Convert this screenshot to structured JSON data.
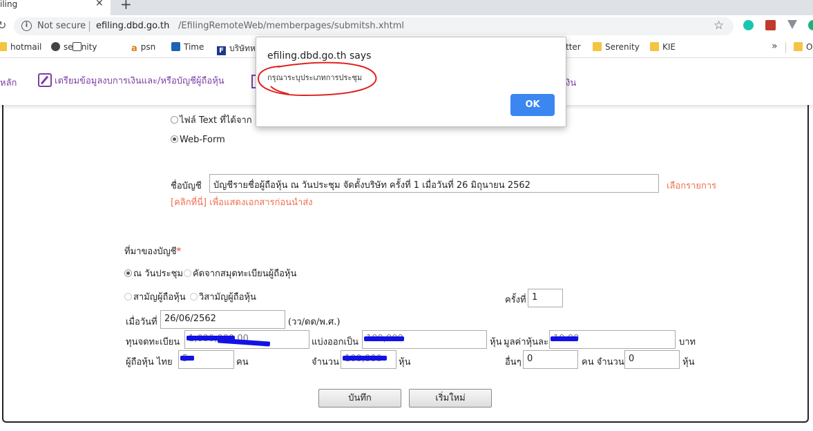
{
  "browser": {
    "tab_title": "iling",
    "address": {
      "security_label": "Not secure",
      "separator": "|",
      "host": "efiling.dbd.go.th",
      "path": "/EfilingRemoteWeb/memberpages/submitsh.xhtml"
    },
    "bookmarks": [
      {
        "label": "hotmail",
        "icon": "folder-icon"
      },
      {
        "label": "serenity",
        "icon": "github-icon"
      },
      {
        "label": "psn",
        "icon": "book-icon"
      },
      {
        "label": "Time",
        "icon": "amazon-icon"
      },
      {
        "label": "บริษัทห",
        "icon": "time-icon"
      },
      {
        "label": "tter",
        "icon": "folder-icon"
      },
      {
        "label": "Serenity",
        "icon": "folder-icon"
      },
      {
        "label": "KIE",
        "icon": "folder-icon"
      },
      {
        "label": "O",
        "icon": "folder-icon"
      }
    ],
    "more_bookmarks": "»"
  },
  "nav": {
    "home_label": "หลัก",
    "item1_label": "เตรียมข้อมูลงบการเงินและ/หรือบัญชีผู้ถือหุ้น",
    "item3_label": "งิน"
  },
  "form": {
    "source_text_file": "ไฟล์ Text ที่ได้จาก",
    "source_webform": "Web-Form",
    "account_name_label": "ชื่อบัญชี",
    "account_name_value": "บัญชีรายชื่อผู้ถือหุ้น  ณ วันประชุม จัดตั้งบริษัท ครั้งที่ 1  เมื่อวันที่ 26 มิถุนายน 2562",
    "select_item_link": "เลือกรายการ",
    "preview_link": "[คลิกที่นี่] เพื่อแสดงเอกสารก่อนนำส่ง",
    "origin_label": "ที่มาของบัญชี",
    "required_mark": "*",
    "origin_meeting": "ณ วันประชุม",
    "origin_register": "คัดจากสมุดทะเบียนผู้ถือหุ้น",
    "meeting_ordinary": "สามัญผู้ถือหุ้น",
    "meeting_extraordinary": "วิสามัญผู้ถือหุ้น",
    "times_label": "ครั้งที่",
    "times_value": "1",
    "date_label": "เมื่อวันที่",
    "date_value": "26/06/2562",
    "date_format": "(วว/ดด/พ.ศ.)",
    "capital_label": "ทุนจดทะเบียน",
    "capital_value": "1,000,000.00",
    "divided_label": "แบ่งออกเป็น",
    "divided_value": "100,000",
    "share_unit": "หุ้น",
    "par_label": "มูลค่าหุ้นละ",
    "par_value": "10.00",
    "baht_unit": "บาท",
    "thai_holders_label": "ผู้ถือหุ้น ไทย",
    "thai_holders_value": "5",
    "person_unit": "คน",
    "amount_label": "จำนวน",
    "amount_value": "100,000",
    "other_label": "อื่นๆ",
    "other_holders_value": "0",
    "other_person_amount": "คน จำนวน",
    "other_amount_value": "0",
    "save_button": "บันทึก",
    "reset_button": "เริ่มใหม่"
  },
  "dialog": {
    "title": "efiling.dbd.go.th says",
    "message": "กรุณาระบุประเภทการประชุม",
    "ok_label": "OK",
    "annotation_color": "#e02020"
  },
  "colors": {
    "nav_purple": "#7b3fa4",
    "link_orange": "#ef6f50",
    "dialog_blue": "#3b86f0",
    "redaction_blue": "#1212e6"
  }
}
